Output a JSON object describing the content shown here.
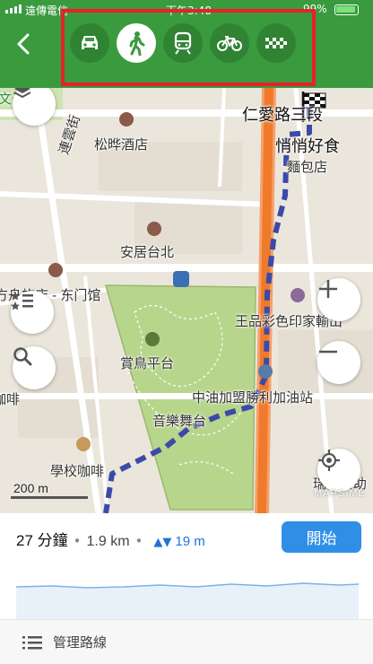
{
  "status_bar": {
    "carrier": "遠傳電信",
    "time": "下午3:48",
    "battery": "99%"
  },
  "header": {
    "back_icon": "chevron-left-icon",
    "transport_modes": [
      {
        "icon": "car-icon",
        "active": false
      },
      {
        "icon": "walking-person-icon",
        "active": true
      },
      {
        "icon": "train-icon",
        "active": false
      },
      {
        "icon": "bicycle-icon",
        "active": false
      },
      {
        "icon": "taxi-icon",
        "active": false
      }
    ],
    "highlight_color": "#e8202a",
    "bar_color": "#3a9a3e"
  },
  "map": {
    "labels": {
      "park": "文光公園",
      "road_north": "仁愛路三段",
      "shop": "悄悄好食",
      "shop_sub": "麵包店",
      "hotel1": "松晔酒店",
      "street": "連雲街",
      "hotel2": "安居台北",
      "hotel3": "方舟旅店 - 东门馆",
      "print_shop": "王品彩色印家輸出",
      "bird_stage": "賞鳥平台",
      "gas_station": "中油加盟勝利加油站",
      "music_stage": "音樂舞台",
      "left_cafe": "咖啡",
      "school_cafe": "學校咖啡",
      "right_clinic": "瑞安自助",
      "left_edge": "咖啡"
    },
    "scale": "200 m",
    "watermark": "MAPS.ME",
    "route_color": "#3b4aa8",
    "main_road_color": "#f07a2a"
  },
  "route_summary": {
    "duration": "27 分鐘",
    "distance": "1.9 km",
    "elevation": "19 m",
    "start_button": "開始"
  },
  "manage_routes": "管理路線"
}
